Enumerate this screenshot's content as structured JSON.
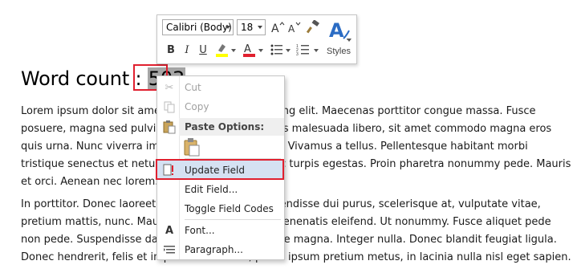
{
  "document": {
    "heading_label": "Word count : ",
    "field_value": "503",
    "paragraph1": [
      "Lorem ipsum dolor sit amet, consectetuer adipiscing elit. Maecenas porttitor congue massa. Fusce",
      "posuere, magna sed pulvinar ultricies, purus lectus malesuada libero, sit amet commodo magna eros",
      "quis urna. Nunc viverra imperdiet enim. Fusce est. Vivamus a tellus. Pellentesque habitant morbi",
      "tristique senectus et netus et malesuada fames ac turpis egestas. Proin pharetra nonummy pede. Mauris",
      "et orci. Aenean nec lorem."
    ],
    "paragraph2": [
      "In porttitor. Donec laoreet nonummy augue. Suspendisse dui purus, scelerisque at, vulputate vitae,",
      "pretium mattis, nunc. Mauris eget neque at sem venenatis eleifend. Ut nonummy. Fusce aliquet pede",
      "non pede. Suspendisse dapibus lorem pellentesque magna. Integer nulla. Donec blandit feugiat ligula.",
      "Donec hendrerit, felis et imperdiet euismod, purus ipsum pretium metus, in lacinia nulla nisl eget sapien."
    ]
  },
  "mini_toolbar": {
    "font_name": "Calibri (Body)",
    "font_size": "18",
    "styles_label": "Styles",
    "colors": {
      "highlight": "#ffff00",
      "font_color": "#e0202f"
    }
  },
  "context_menu": {
    "cut": "Cut",
    "copy": "Copy",
    "paste_options": "Paste Options:",
    "update_field": "Update Field",
    "edit_field": "Edit Field...",
    "toggle_field_codes": "Toggle Field Codes",
    "font": "Font...",
    "paragraph": "Paragraph..."
  }
}
